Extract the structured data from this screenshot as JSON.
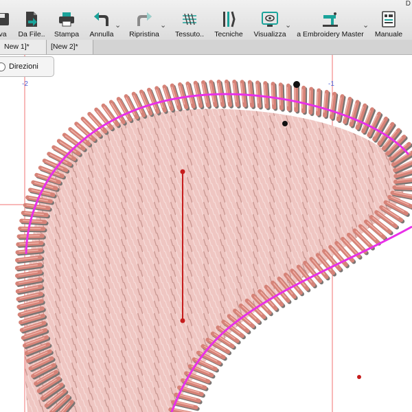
{
  "window": {
    "title_fragment": "D"
  },
  "toolbar": {
    "items": [
      {
        "label": "va",
        "icon": "save-icon"
      },
      {
        "label": "Da File..",
        "icon": "import-file-icon"
      },
      {
        "label": "Stampa",
        "icon": "printer-icon"
      },
      {
        "label": "Annulla",
        "icon": "undo-icon"
      },
      {
        "label": "Ripristina",
        "icon": "redo-icon"
      },
      {
        "label": "Tessuto..",
        "icon": "fabric-icon"
      },
      {
        "label": "Tecniche",
        "icon": "scissors-tools-icon"
      },
      {
        "label": "Visualizza",
        "icon": "view-icon"
      },
      {
        "label": "a Embroidery Master",
        "icon": "sewing-machine-icon"
      },
      {
        "label": "Manuale",
        "icon": "manual-icon"
      }
    ],
    "dropdown_glyph": "⌄",
    "colors": {
      "teal": "#1aa39a",
      "dark": "#3d3d3d"
    }
  },
  "tabs": [
    {
      "label": "New 1]*"
    },
    {
      "label": "[New 2]*"
    }
  ],
  "panel": {
    "direzioni_label": "Direzioni"
  },
  "rulers": {
    "left_label": "-2",
    "right_label": "-1"
  },
  "colors": {
    "stitch_border": "#d68378",
    "stitch_shadow": "#7a7573",
    "fill": "#efc6c2",
    "outline": "#e830e8",
    "guide": "#f07070",
    "direction_line": "#c51c1c"
  }
}
